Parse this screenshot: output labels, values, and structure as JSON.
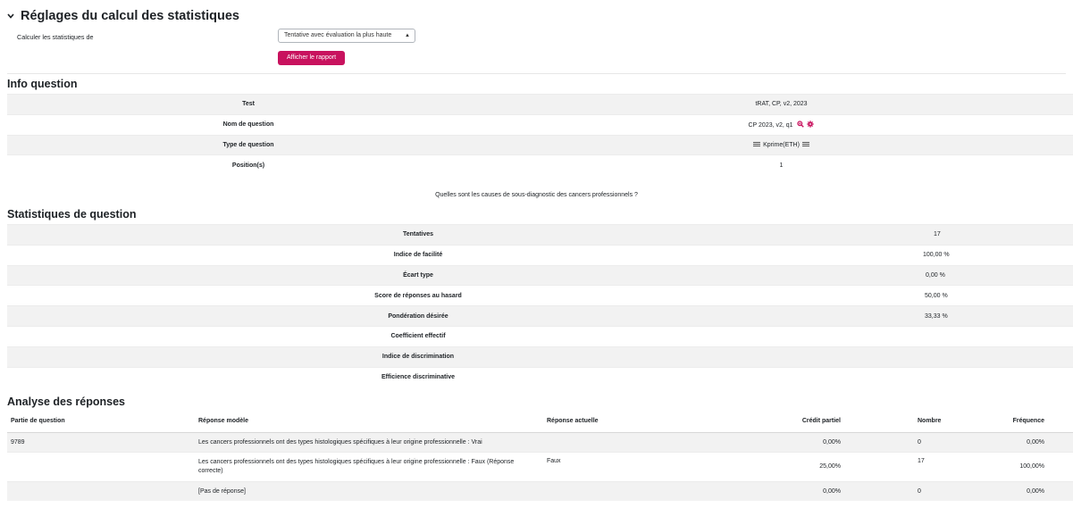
{
  "settings": {
    "title": "Réglages du calcul des statistiques",
    "label": "Calculer les statistiques de",
    "select_value": "Tentative avec évaluation la plus haute",
    "button": "Afficher le rapport"
  },
  "info": {
    "title": "Info question",
    "rows": [
      {
        "label": "Test",
        "value": "tRAT, CP, v2, 2023"
      },
      {
        "label": "Nom de question",
        "value": "CP 2023, v2, q1"
      },
      {
        "label": "Type de question",
        "value": "Kprime(ETH)"
      },
      {
        "label": "Position(s)",
        "value": "1"
      }
    ],
    "question_text": "Quelles sont les causes de sous-diagnostic des cancers professionnels ?"
  },
  "stats": {
    "title": "Statistiques de question",
    "rows": [
      {
        "label": "Tentatives",
        "value": "17"
      },
      {
        "label": "Indice de facilité",
        "value": "100,00 %"
      },
      {
        "label": "Écart type",
        "value": "0,00 %"
      },
      {
        "label": "Score de réponses au hasard",
        "value": "50,00 %"
      },
      {
        "label": "Pondération désirée",
        "value": "33,33 %"
      },
      {
        "label": "Coefficient effectif",
        "value": ""
      },
      {
        "label": "Indice de discrimination",
        "value": ""
      },
      {
        "label": "Efficience discriminative",
        "value": ""
      }
    ]
  },
  "analysis": {
    "title": "Analyse des réponses",
    "headers": [
      "Partie de question",
      "Réponse modèle",
      "Réponse actuelle",
      "Crédit partiel",
      "Nombre",
      "Fréquence"
    ],
    "rows": [
      {
        "part": "9789",
        "model": "Les cancers professionnels ont des types histologiques spécifiques à leur origine professionnelle : Vrai",
        "actual": "",
        "credit": "0,00%",
        "count": "0",
        "freq": "0,00%"
      },
      {
        "part": "",
        "model": "Les cancers professionnels ont des types histologiques spécifiques à leur origine professionnelle : Faux (Réponse correcte)",
        "actual": "Faux",
        "credit": "25,00%",
        "count": "17",
        "freq": "100,00%"
      },
      {
        "part": "",
        "model": "[Pas de réponse]",
        "actual": "",
        "credit": "0,00%",
        "count": "0",
        "freq": "0,00%"
      }
    ]
  },
  "colors": {
    "accent": "#c8125e",
    "row_stripe": "#f2f2f2"
  },
  "icons": {
    "collapse": "chevron-down-icon",
    "preview": "magnifier-icon",
    "edit": "gear-icon",
    "type": "lines-icon"
  }
}
